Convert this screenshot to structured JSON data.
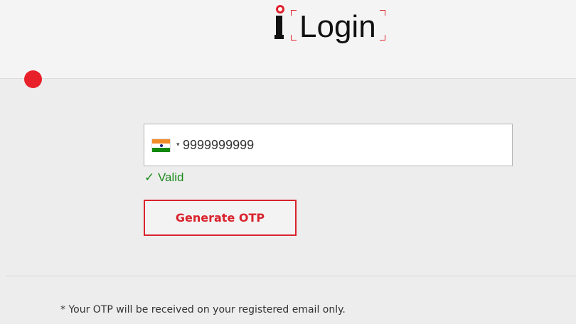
{
  "logo": {
    "text": "Login",
    "letter": "i"
  },
  "phone": {
    "country_flag": "india-flag-icon",
    "country_caret": "▾",
    "value": "9999999999"
  },
  "validation": {
    "text": "✓ Valid",
    "color": "#1d8a1d"
  },
  "generate_button": {
    "label": "Generate OTP",
    "color": "#d9232d"
  },
  "note": {
    "text": "* Your OTP will be received on your registered email only."
  },
  "colors": {
    "accent": "#e0202a",
    "panel_bg": "#ededed"
  }
}
